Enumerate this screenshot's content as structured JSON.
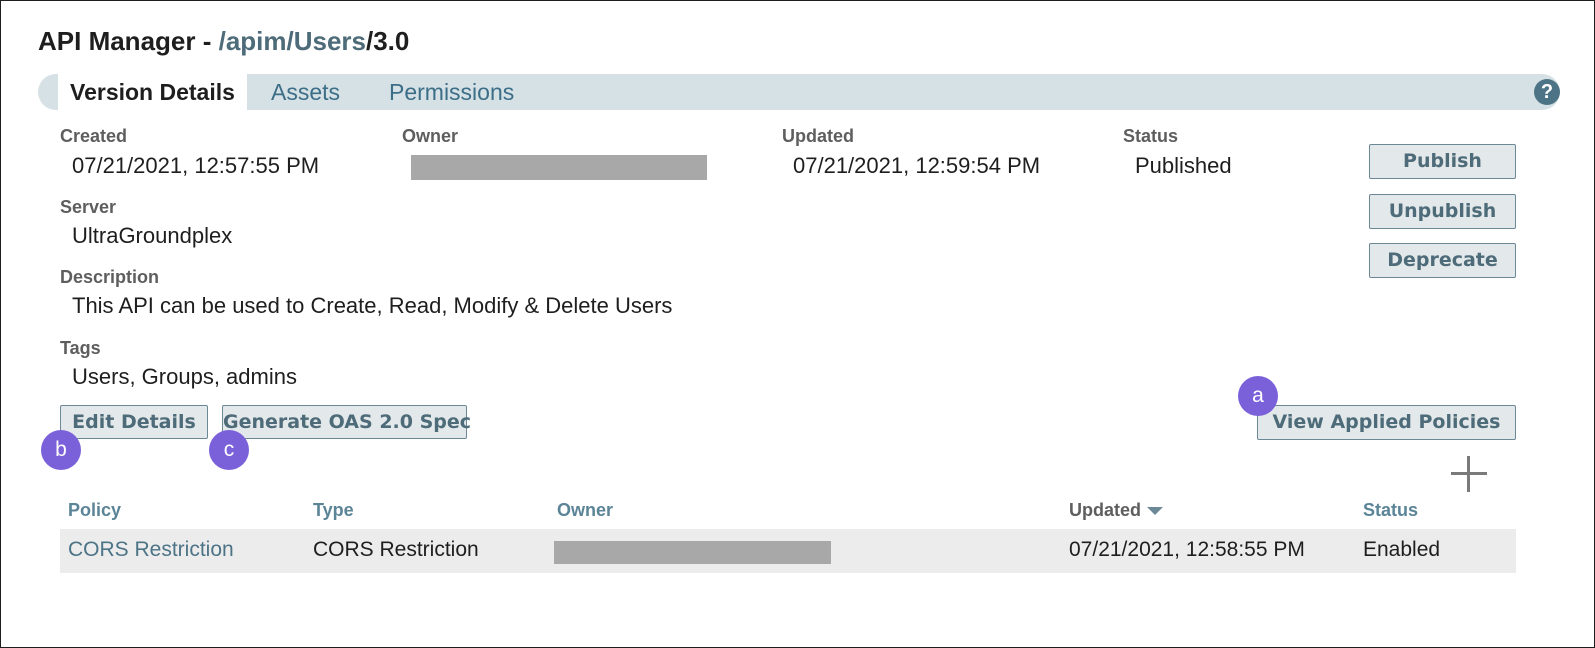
{
  "header": {
    "title_prefix": "API Manager - ",
    "title_path": "/apim/Users",
    "title_version": "/3.0"
  },
  "tabs": [
    {
      "label": "Version Details",
      "active": true
    },
    {
      "label": "Assets",
      "active": false
    },
    {
      "label": "Permissions",
      "active": false
    }
  ],
  "help": {
    "glyph": "?"
  },
  "details": {
    "created_label": "Created",
    "created_value": "07/21/2021, 12:57:55 PM",
    "owner_label": "Owner",
    "updated_label": "Updated",
    "updated_value": "07/21/2021, 12:59:54 PM",
    "status_label": "Status",
    "status_value": "Published",
    "server_label": "Server",
    "server_value": "UltraGroundplex",
    "description_label": "Description",
    "description_value": "This API can be used to Create, Read, Modify & Delete Users",
    "tags_label": "Tags",
    "tags_value": "Users, Groups, admins"
  },
  "actions": {
    "publish": "Publish",
    "unpublish": "Unpublish",
    "deprecate": "Deprecate",
    "edit_details": "Edit Details",
    "generate_spec": "Generate OAS 2.0 Spec",
    "view_policies": "View Applied Policies"
  },
  "badges": {
    "a": "a",
    "b": "b",
    "c": "c"
  },
  "policies_table": {
    "columns": [
      "Policy",
      "Type",
      "Owner",
      "Updated",
      "Status"
    ],
    "sort_column": "Updated",
    "sort_direction": "descending",
    "rows": [
      {
        "policy": "CORS Restriction",
        "type": "CORS Restriction",
        "owner": "",
        "updated": "07/21/2021, 12:58:55 PM",
        "status": "Enabled"
      }
    ]
  },
  "colors": {
    "accent": "#4d6b78",
    "tab_bar": "#d6e1e5",
    "badge": "#7b61d9",
    "redaction": "#a8a8a8"
  }
}
